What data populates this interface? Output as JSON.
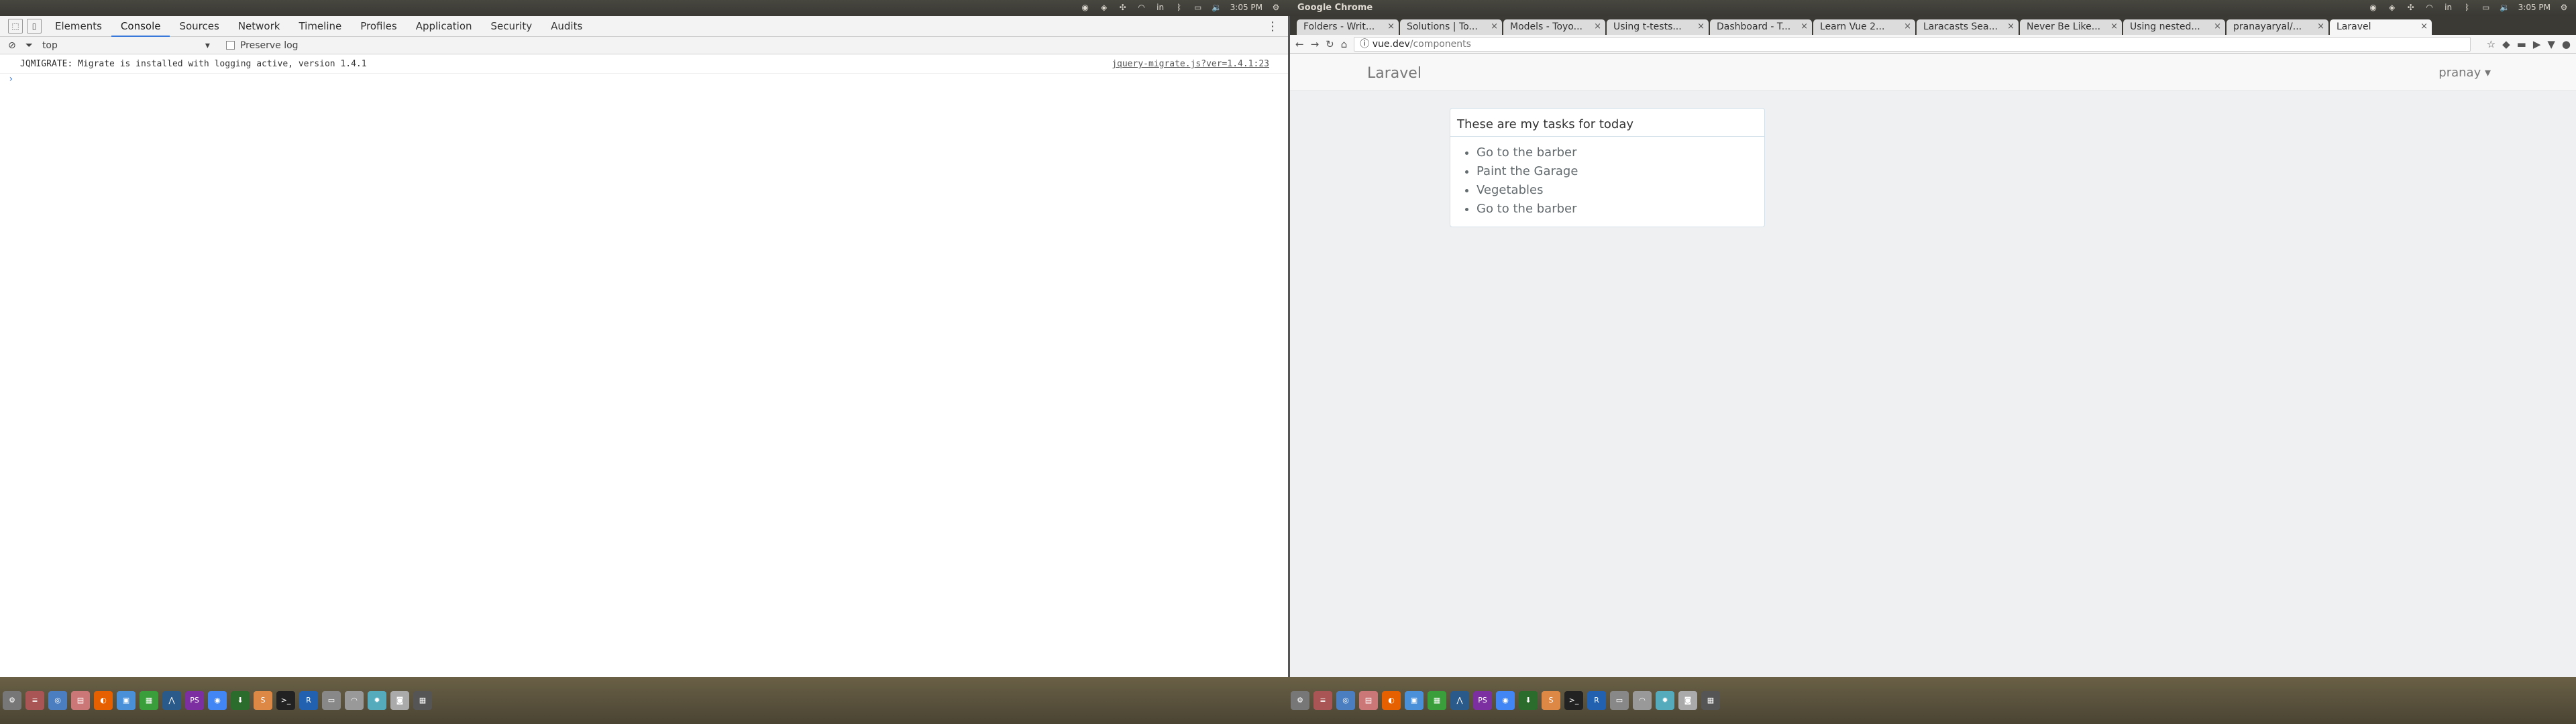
{
  "left": {
    "panel": {
      "tray": [
        "chrome",
        "shield",
        "net",
        "wifi",
        "in",
        "bt",
        "bat",
        "vol"
      ],
      "clock": "3:05 PM",
      "app_title": "Google Chrome"
    },
    "devtools": {
      "tabs": [
        "Elements",
        "Console",
        "Sources",
        "Network",
        "Timeline",
        "Profiles",
        "Application",
        "Security",
        "Audits"
      ],
      "active_tab": "Console",
      "context": "top",
      "preserve_log": "Preserve log",
      "messages": [
        {
          "text": "JQMIGRATE: Migrate is installed with logging active, version 1.4.1",
          "source": "jquery-migrate.js?ver=1.4.1:23"
        }
      ],
      "prompt": "›"
    }
  },
  "right": {
    "panel": {
      "title": "Google Chrome",
      "clock": "3:05 PM"
    },
    "tabs": [
      {
        "label": "Folders - Writ..."
      },
      {
        "label": "Solutions | To..."
      },
      {
        "label": "Models - Toyo..."
      },
      {
        "label": "Using t-tests..."
      },
      {
        "label": "Dashboard - T..."
      },
      {
        "label": "Learn Vue 2..."
      },
      {
        "label": "Laracasts Sea..."
      },
      {
        "label": "Never Be Like..."
      },
      {
        "label": "Using nested..."
      },
      {
        "label": "pranayaryal/..."
      },
      {
        "label": "Laravel",
        "active": true
      }
    ],
    "omnibox": {
      "host": "vue.dev",
      "path": "/components"
    },
    "navbar": {
      "brand": "Laravel",
      "user": "pranay ▾"
    },
    "card": {
      "heading": "These are my tasks for today",
      "tasks": [
        "Go to the barber",
        "Paint the Garage",
        "Vegetables",
        "Go to the barber"
      ]
    }
  },
  "dock": {
    "icons": [
      "settings-icon",
      "mixer-icon",
      "chromium-icon",
      "files-icon",
      "firefox-icon",
      "docs-icon",
      "calc-icon",
      "wireshark-icon",
      "phpstorm-icon",
      "chrome-icon",
      "download-icon",
      "sublime-icon",
      "terminal-icon",
      "r-icon",
      "drive-icon",
      "wifi-icon",
      "sun-icon",
      "camera-icon",
      "workspace-icon"
    ]
  }
}
